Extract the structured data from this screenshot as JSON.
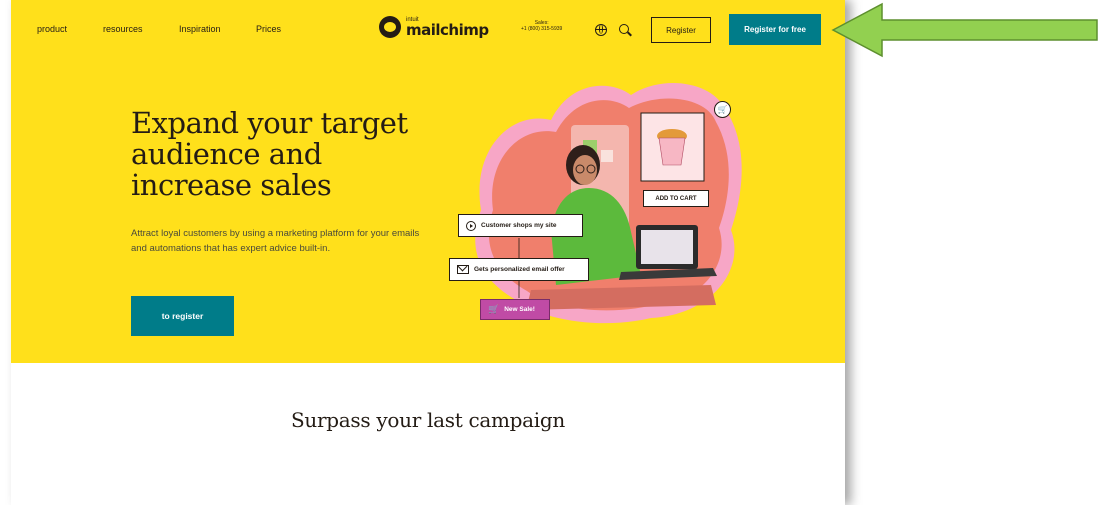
{
  "nav": {
    "links": [
      "product",
      "resources",
      "Inspiration",
      "Prices"
    ],
    "logo_intuit": "intuit",
    "logo_name": "mailchimp",
    "sales_label": "Sales:",
    "sales_phone": "+1 (800) 315-5939",
    "register_label": "Register",
    "register_free_label": "Register for free"
  },
  "hero": {
    "title": "Expand your target audience and increase sales",
    "description": "Attract loyal customers by using a marketing platform for your emails and automations that has expert advice built-in.",
    "cta_label": "to register",
    "background_color": "#ffe01b",
    "cta_color": "#007c89"
  },
  "illustration": {
    "steps": [
      "Customer shops my site",
      "Gets personalized email offer",
      "New Sale!"
    ],
    "add_to_cart_label": "ADD TO CART",
    "icons": [
      "play-icon",
      "mail-icon",
      "cart-icon"
    ]
  },
  "section": {
    "title": "Surpass your last campaign"
  },
  "annotation": {
    "arrow_color": "#92d050",
    "arrow_points_to": "Register for free"
  }
}
